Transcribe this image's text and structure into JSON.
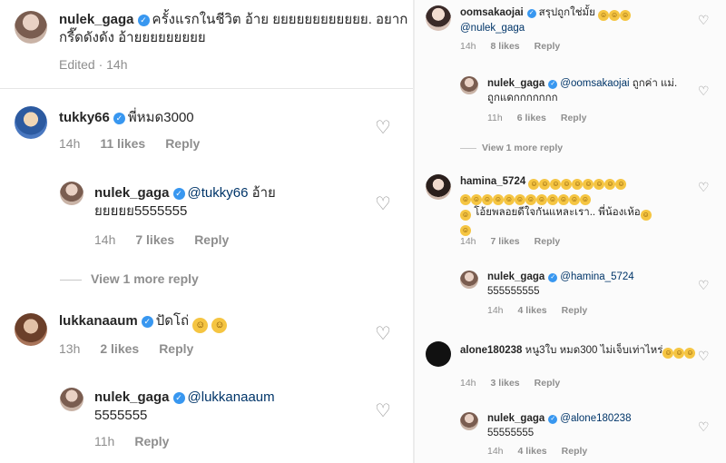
{
  "verified_mark": "✓",
  "heart_glyph": "♡",
  "emoji_glyph": "☺",
  "left": {
    "top_comment": {
      "username": "nulek_gaga",
      "text": "ครั้งแรกในชีวิต อ้าย ยยยยยยยยยยยย. อยากกรี๊ดดังดัง อ้ายยยยยยยยย",
      "meta_text": "Edited · 14h"
    },
    "comments": [
      {
        "username": "tukky66",
        "text": "พี่หมด3000",
        "time": "14h",
        "likes": "11 likes",
        "reply": "Reply",
        "reply_thread": {
          "username": "nulek_gaga",
          "mention": "@tukky66",
          "text": "อ้าย ยยยยย5555555",
          "time": "14h",
          "likes": "7 likes",
          "reply": "Reply"
        },
        "view_more": "View 1 more reply"
      },
      {
        "username": "lukkanaaum",
        "text": "ปัดโถ่",
        "time": "13h",
        "likes": "2 likes",
        "reply": "Reply",
        "reply_thread": {
          "username": "nulek_gaga",
          "mention": "@lukkanaaum",
          "text": "5555555",
          "time": "11h",
          "reply": "Reply"
        }
      }
    ]
  },
  "right": {
    "comments": [
      {
        "username": "oomsakaojai",
        "text": "สรุปถูกใช่มั้ย",
        "mention": "@nulek_gaga",
        "time": "14h",
        "likes": "8 likes",
        "reply": "Reply",
        "reply_thread": {
          "username": "nulek_gaga",
          "mention": "@oomsakaojai",
          "text": "ถูกค่า แม่. ถูกแดกกกกกกก",
          "time": "11h",
          "likes": "6 likes",
          "reply": "Reply"
        },
        "view_more": "View 1 more reply"
      },
      {
        "username": "hamina_5724",
        "text": "โอ้ยพลอยดีใจกันแหละเรา.. พี่น้องเห้อ",
        "time": "14h",
        "likes": "7 likes",
        "reply": "Reply",
        "reply_thread": {
          "username": "nulek_gaga",
          "mention": "@hamina_5724",
          "text": "555555555",
          "time": "14h",
          "likes": "4 likes",
          "reply": "Reply"
        }
      },
      {
        "username": "alone180238",
        "text": "หนู3ใบ หมด300 ไม่เจ็บเท่าไหร่",
        "time": "14h",
        "likes": "3 likes",
        "reply": "Reply",
        "reply_thread": {
          "username": "nulek_gaga",
          "mention": "@alone180238",
          "text": "55555555",
          "time": "14h",
          "likes": "4 likes",
          "reply": "Reply"
        }
      }
    ]
  }
}
